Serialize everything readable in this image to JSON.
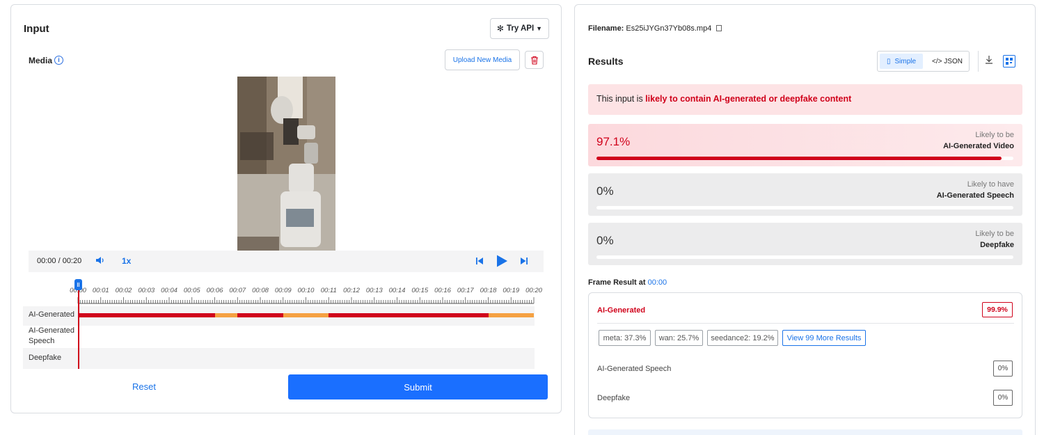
{
  "input": {
    "title": "Input",
    "try_api": "Try API",
    "media_label": "Media",
    "upload_label": "Upload New Media",
    "player": {
      "time": "00:00 / 00:20",
      "speed": "1x",
      "progress": 0.0
    },
    "timeline": {
      "ticks": [
        "00:00",
        "00:01",
        "00:02",
        "00:03",
        "00:04",
        "00:05",
        "00:06",
        "00:07",
        "00:08",
        "00:09",
        "00:10",
        "00:11",
        "00:12",
        "00:13",
        "00:14",
        "00:15",
        "00:16",
        "00:17",
        "00:18",
        "00:19",
        "00:20"
      ],
      "rows": [
        {
          "label": "AI-Generated"
        },
        {
          "label": "AI-Generated Speech"
        },
        {
          "label": "Deepfake"
        }
      ],
      "ai_generated_segments": [
        {
          "start": 0,
          "end": 6,
          "level": "high"
        },
        {
          "start": 6,
          "end": 7,
          "level": "medium"
        },
        {
          "start": 7,
          "end": 9,
          "level": "high"
        },
        {
          "start": 9,
          "end": 11,
          "level": "medium"
        },
        {
          "start": 11,
          "end": 18,
          "level": "high"
        },
        {
          "start": 18,
          "end": 20,
          "level": "medium"
        }
      ]
    },
    "reset_label": "Reset",
    "submit_label": "Submit"
  },
  "results": {
    "filename_label": "Filename:",
    "filename": "Es25iJYGn37Yb08s.mp4",
    "title": "Results",
    "view_simple": "Simple",
    "view_json": "</> JSON",
    "alert_prefix": "This input is ",
    "alert_emphasis": "likely to contain AI-generated or deepfake content",
    "scores": [
      {
        "pct": "97.1%",
        "value": 0.971,
        "line1": "Likely to be",
        "line2": "AI-Generated Video"
      },
      {
        "pct": "0%",
        "value": 0,
        "line1": "Likely to have",
        "line2": "AI-Generated Speech"
      },
      {
        "pct": "0%",
        "value": 0,
        "line1": "Likely to be",
        "line2": "Deepfake"
      }
    ],
    "frame_label": "Frame Result at ",
    "frame_time": "00:00",
    "frame": {
      "ai_label": "AI-Generated",
      "ai_pct": "99.9%",
      "chips": [
        "meta: 37.3%",
        "wan: 25.7%",
        "seedance2: 19.2%"
      ],
      "more": "View 99 More Results",
      "speech_label": "AI-Generated Speech",
      "speech_pct": "0%",
      "deepfake_label": "Deepfake",
      "deepfake_pct": "0%"
    }
  },
  "colors": {
    "high": "#d0021b",
    "medium": "#f5a142",
    "accent": "#1a73e8",
    "alert_bg": "#fde3e5"
  }
}
